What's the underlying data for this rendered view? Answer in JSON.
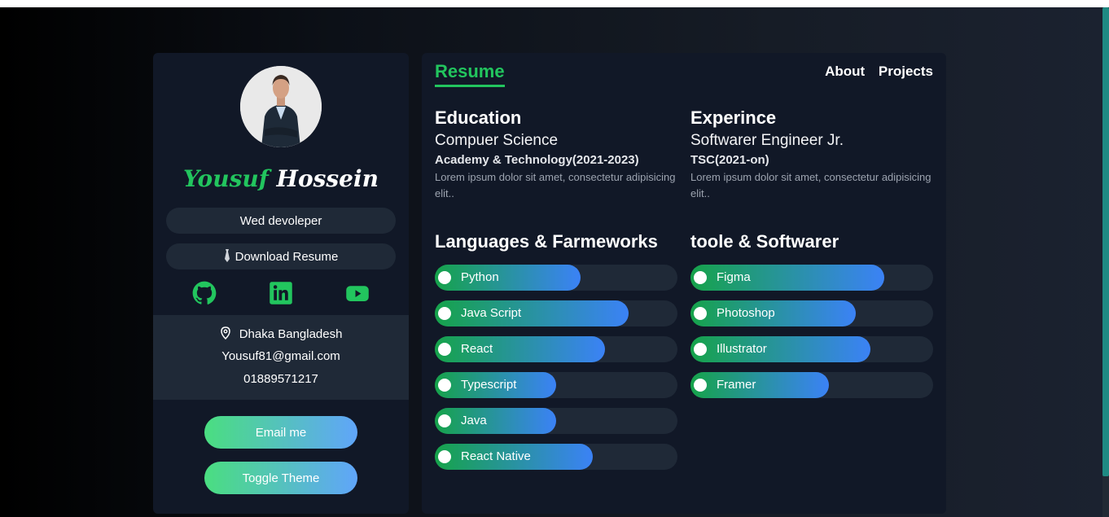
{
  "profile": {
    "first_name": "Yousuf",
    "last_name": "Hossein",
    "role": "Wed devoleper",
    "download_label": "Download Resume",
    "socials": [
      {
        "icon": "github-icon"
      },
      {
        "icon": "linkedin-icon"
      },
      {
        "icon": "youtube-icon"
      }
    ],
    "location": "Dhaka Bangladesh",
    "email": "Yousuf81@gmail.com",
    "phone": "01889571217",
    "email_button": "Email me",
    "theme_button": "Toggle Theme"
  },
  "header": {
    "active_tab": "Resume",
    "nav": [
      "About",
      "Projects"
    ]
  },
  "education": {
    "heading": "Education",
    "subject": "Compuer Science",
    "institution": "Academy & Technology(2021-2023)",
    "description": "Lorem ipsum dolor sit amet, consectetur adipisicing elit.."
  },
  "experience": {
    "heading": "Experince",
    "title": "Softwarer Engineer Jr.",
    "company": "TSC(2021-on)",
    "description": "Lorem ipsum dolor sit amet, consectetur adipisicing elit.."
  },
  "languages": {
    "heading": "Languages & Farmeworks",
    "items": [
      {
        "label": "Python",
        "level": 0.6
      },
      {
        "label": "Java Script",
        "level": 0.8
      },
      {
        "label": "React",
        "level": 0.7
      },
      {
        "label": "Typescript",
        "level": 0.5
      },
      {
        "label": "Java",
        "level": 0.5
      },
      {
        "label": "React Native",
        "level": 0.65
      }
    ]
  },
  "tools": {
    "heading": "toole & Softwarer",
    "items": [
      {
        "label": "Figma",
        "level": 0.8
      },
      {
        "label": "Photoshop",
        "level": 0.68
      },
      {
        "label": "Illustrator",
        "level": 0.74
      },
      {
        "label": "Framer",
        "level": 0.57
      }
    ]
  },
  "colors": {
    "accent": "#22c55e",
    "card": "#111827",
    "muted_fill": "#1f2937"
  }
}
